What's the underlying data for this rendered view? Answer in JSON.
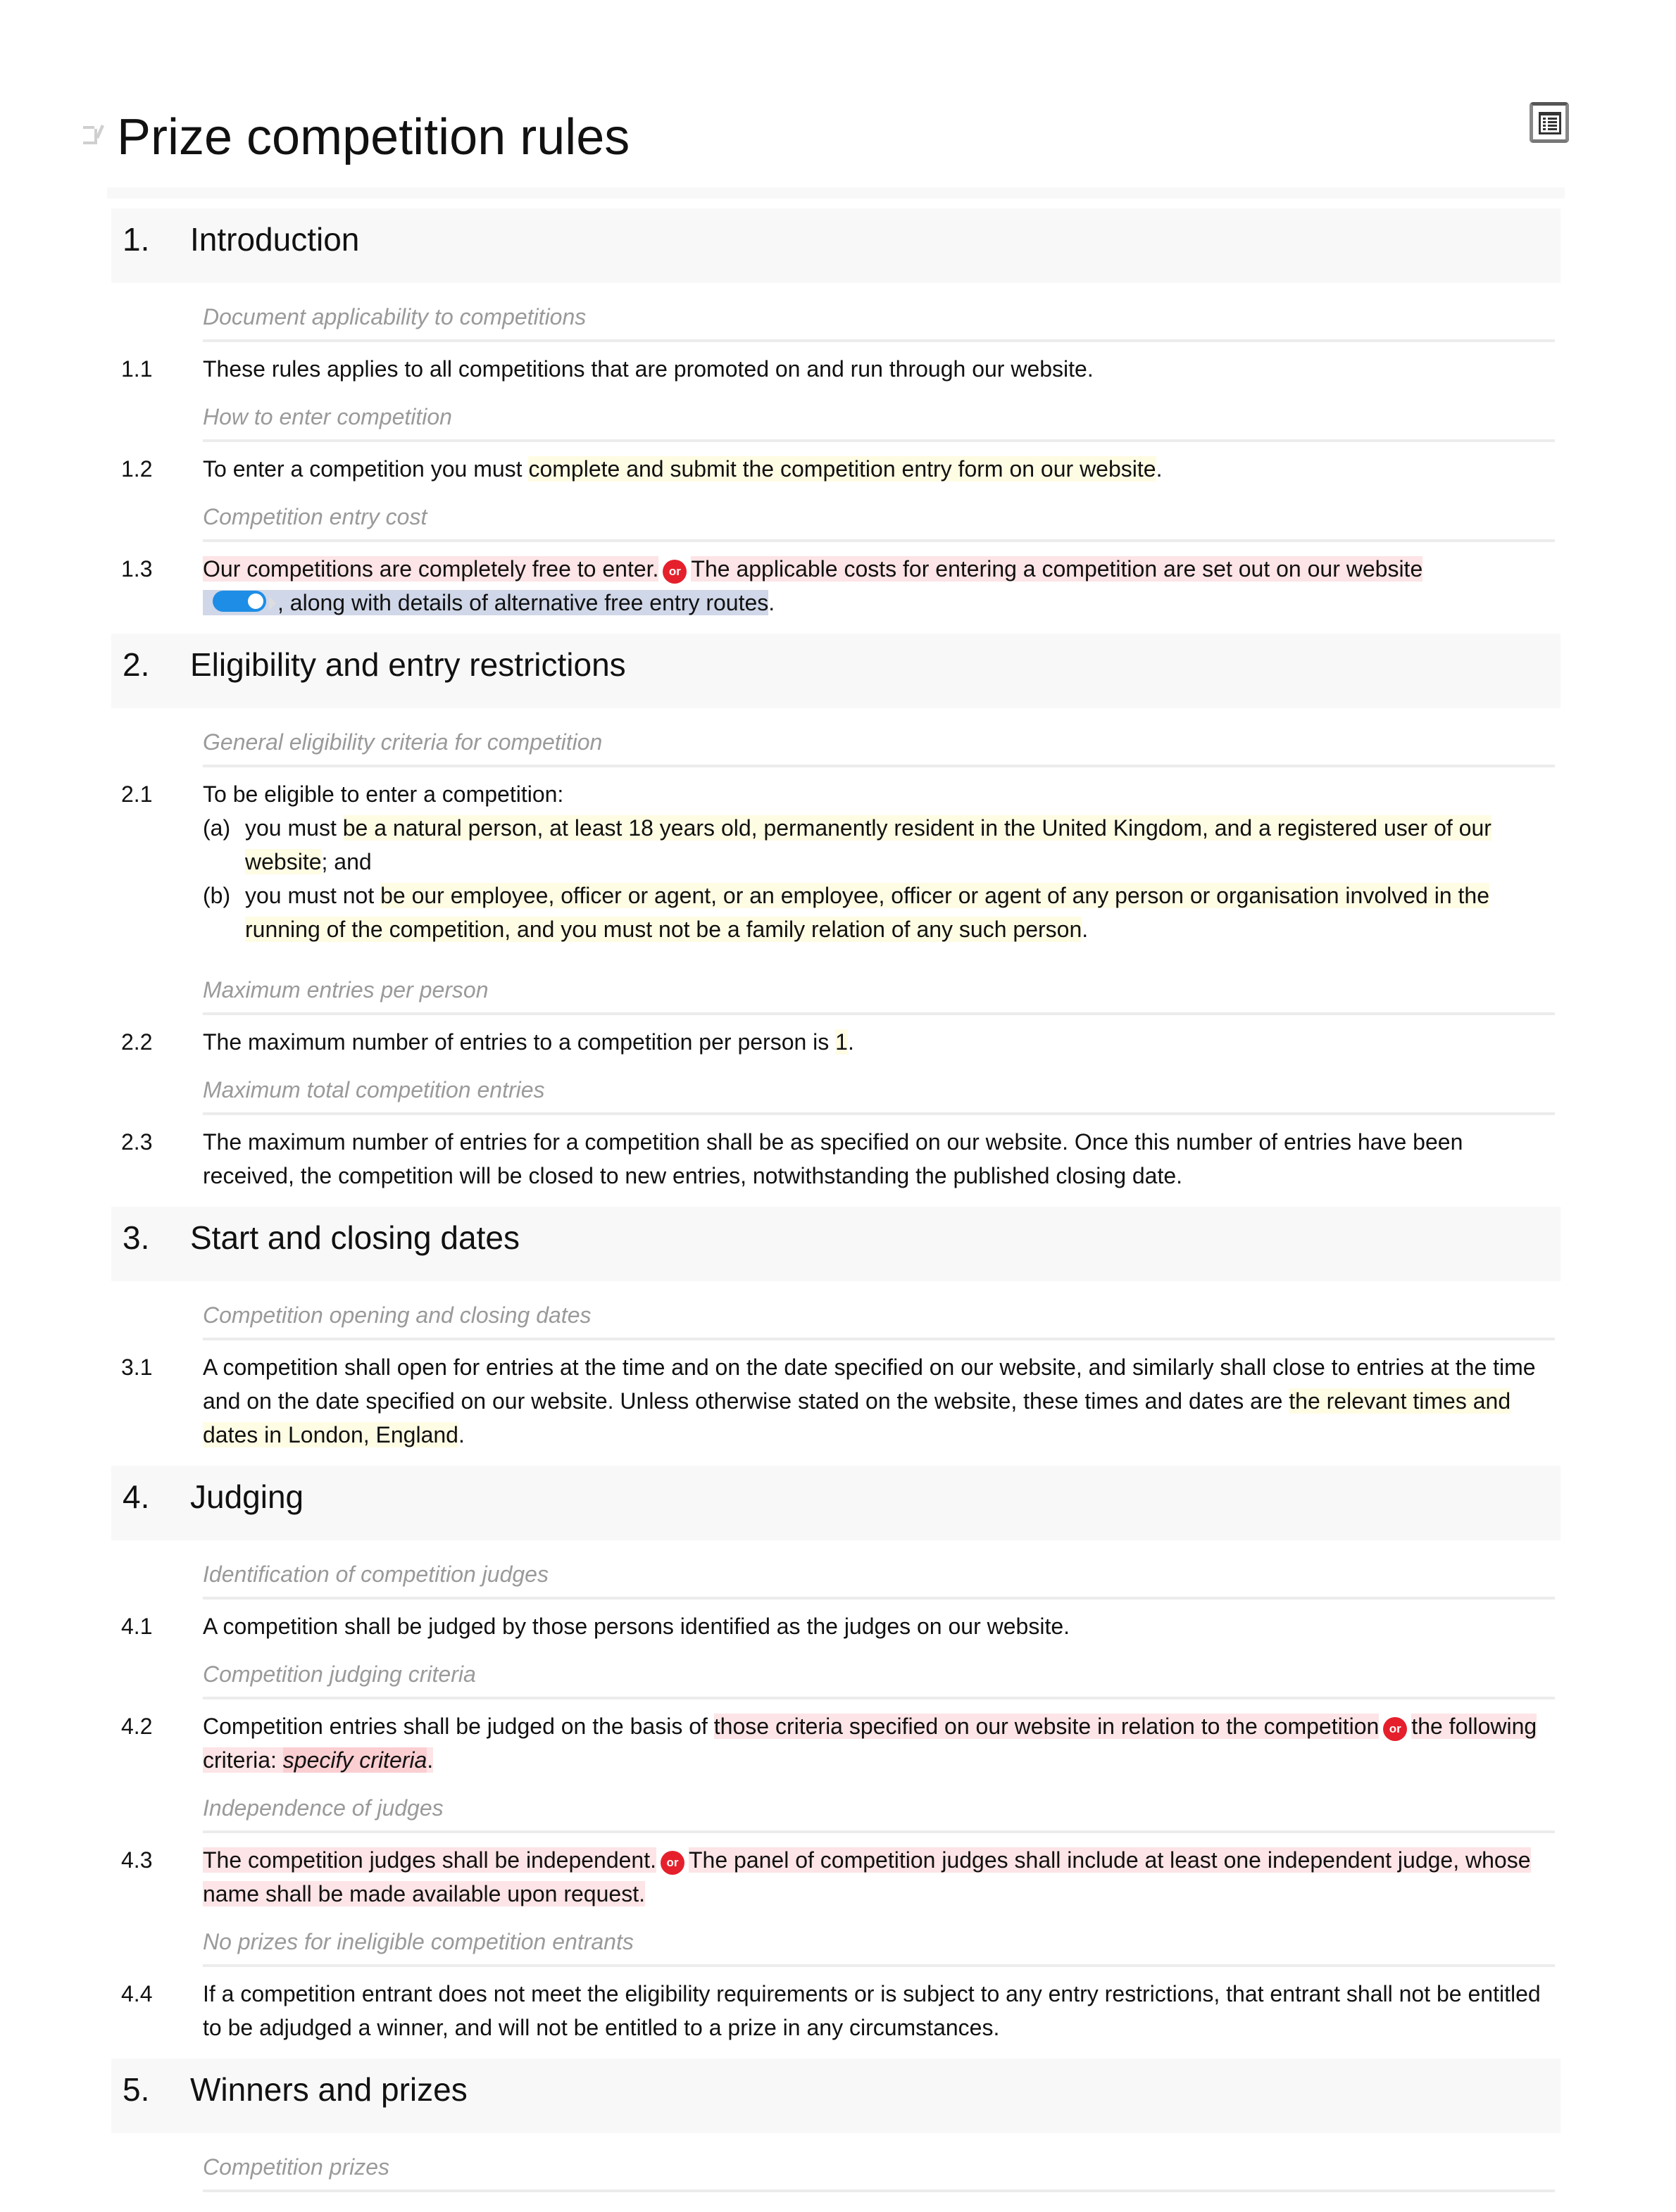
{
  "document": {
    "title": "Prize competition rules",
    "edit_icon": "pencil-edit-icon",
    "toc_icon": "table-of-contents-icon"
  },
  "sections": [
    {
      "num": "1.",
      "title": "Introduction",
      "clauses": [
        {
          "subhead": "Document applicability to competitions",
          "num": "1.1",
          "text": "These rules applies to all competitions that are promoted on and run through our website."
        },
        {
          "subhead": "How to enter competition",
          "num": "1.2",
          "pre": "To enter a competition you must ",
          "hl": "complete and submit the competition entry form on our website",
          "post": "."
        },
        {
          "subhead": "Competition entry cost",
          "num": "1.3",
          "opt_a": "Our competitions are completely free to enter.",
          "or_label": "or",
          "opt_b": "The applicable costs for entering a competition are set out on our website",
          "opt_b_tail": ", along with details of alternative free entry routes",
          "post": ".",
          "toggle_state": "on"
        }
      ]
    },
    {
      "num": "2.",
      "title": "Eligibility and entry restrictions",
      "clauses": [
        {
          "subhead": "General eligibility criteria for competition",
          "num": "2.1",
          "text": "To be eligible to enter a competition:",
          "items": [
            {
              "letter": "(a)",
              "pre": "you must ",
              "hl": "be a natural person, at least 18 years old, permanently resident in the United Kingdom, and a registered user of our website",
              "post": "; and"
            },
            {
              "letter": "(b)",
              "pre": "you must not ",
              "hl": "be our employee, officer or agent, or an employee, officer or agent of any person or organisation involved in the running of the competition, and you must not be a family relation of any such person",
              "post": "."
            }
          ]
        },
        {
          "subhead": "Maximum entries per person",
          "num": "2.2",
          "pre": "The maximum number of entries to a competition per person is ",
          "hl": "1",
          "post": "."
        },
        {
          "subhead": "Maximum total competition entries",
          "num": "2.3",
          "text": "The maximum number of entries for a competition shall be as specified on our website. Once this number of entries have been received, the competition will be closed to new entries, notwithstanding the published closing date."
        }
      ]
    },
    {
      "num": "3.",
      "title": "Start and closing dates",
      "clauses": [
        {
          "subhead": "Competition opening and closing dates",
          "num": "3.1",
          "pre": "A competition shall open for entries at the time and on the date specified on our website, and similarly shall close to entries at the time and on the date specified on our website. Unless otherwise stated on the website, these times and dates are ",
          "hl": "the relevant times and dates in London, England",
          "post": "."
        }
      ]
    },
    {
      "num": "4.",
      "title": "Judging",
      "clauses": [
        {
          "subhead": "Identification of competition judges",
          "num": "4.1",
          "text": "A competition shall be judged by those persons identified as the judges on our website."
        },
        {
          "subhead": "Competition judging criteria",
          "num": "4.2",
          "pre": "Competition entries shall be judged on the basis of ",
          "opt_a": "those criteria specified on our website in relation to the competition",
          "or_label": "or",
          "opt_b": "the following criteria: ",
          "placeholder": "specify criteria",
          "post": "."
        },
        {
          "subhead": "Independence of judges",
          "num": "4.3",
          "opt_a": "The competition judges shall be independent.",
          "or_label": "or",
          "opt_b": "The panel of competition judges shall include at least one independent judge, whose name shall be made available upon request."
        },
        {
          "subhead": "No prizes for ineligible competition entrants",
          "num": "4.4",
          "text": "If a competition entrant does not meet the eligibility requirements or is subject to any entry restrictions, that entrant shall not be entitled to be adjudged a winner, and will not be entitled to a prize in any circumstances."
        }
      ]
    },
    {
      "num": "5.",
      "title": "Winners and prizes",
      "clauses": [
        {
          "subhead": "Competition prizes"
        }
      ]
    }
  ]
}
